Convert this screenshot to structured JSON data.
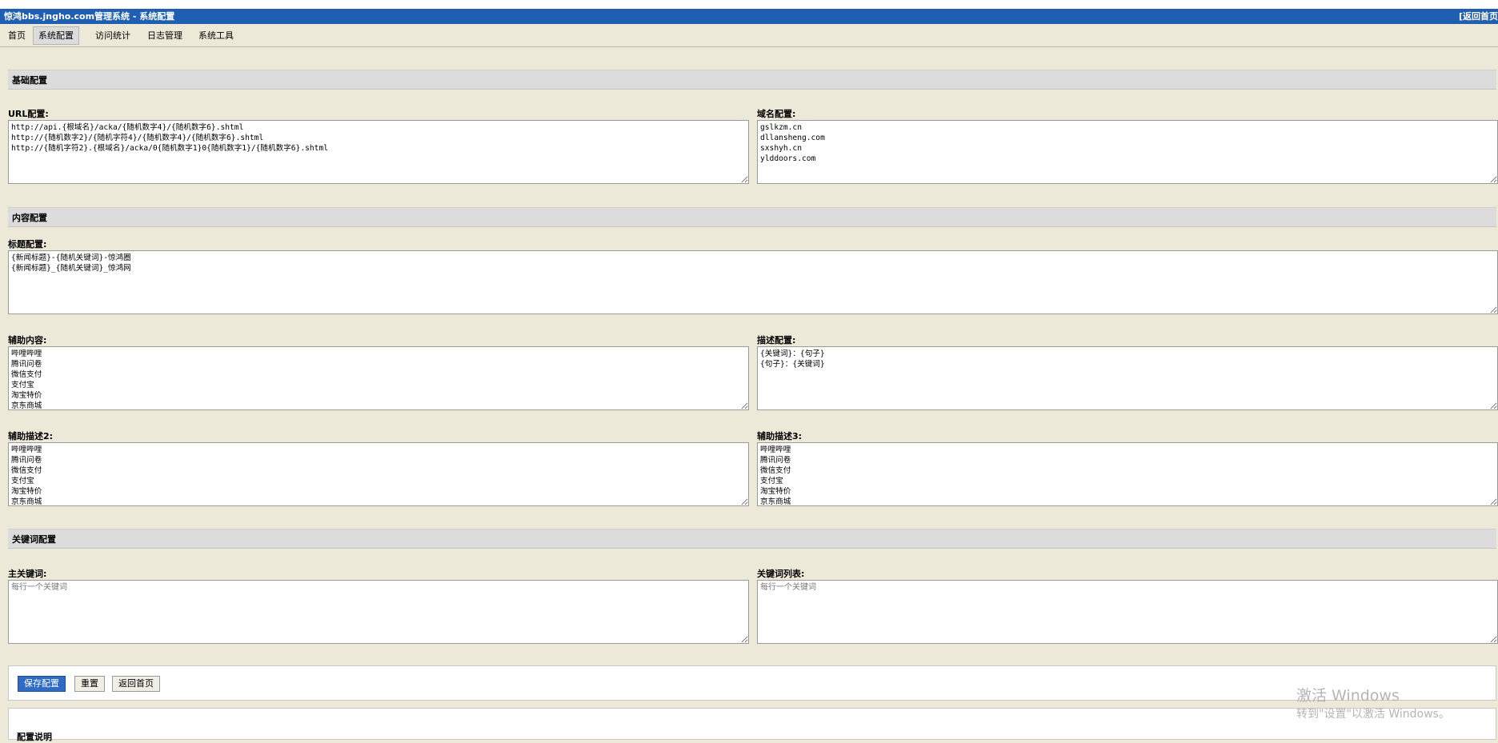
{
  "window": {
    "title": "惊鸿bbs.jngho.com管理系统 - 系统配置",
    "right_link": "[返回首页"
  },
  "menu": [
    {
      "label": "首页",
      "active": false
    },
    {
      "label": "系统配置",
      "active": true
    },
    {
      "label": "访问统计",
      "active": false
    },
    {
      "label": "日志管理",
      "active": false
    },
    {
      "label": "系统工具",
      "active": false
    }
  ],
  "sections": {
    "basic": "基础配置",
    "content": "内容配置",
    "keywords": "关键词配置"
  },
  "fields": {
    "url": {
      "label": "URL配置:",
      "value": "http://api.{根域名}/acka/{随机数字4}/{随机数字6}.shtml\nhttp://{随机数字2}/{随机字符4}/{随机数字4}/{随机数字6}.shtml\nhttp://{随机字符2}.{根域名}/acka/0{随机数字1}0{随机数字1}/{随机数字6}.shtml"
    },
    "domain": {
      "label": "域名配置:",
      "value": "gslkzm.cn\ndllansheng.com\nsxshyh.cn\nylddoors.com"
    },
    "title": {
      "label": "标题配置:",
      "value": "{新闻标题}-{随机关键词}-惊鸿圈\n{新闻标题}_{随机关键词}_惊鸿网"
    },
    "aux_content": {
      "label": "辅助内容:",
      "value": "哔哩哔哩\n腾讯问卷\n微信支付\n支付宝\n淘宝特价\n京东商城"
    },
    "description": {
      "label": "描述配置:",
      "value": "{关键词}：{句子}\n{句子}：{关键词}"
    },
    "aux_desc2": {
      "label": "辅助描述2:",
      "value": "哔哩哔哩\n腾讯问卷\n微信支付\n支付宝\n淘宝特价\n京东商城"
    },
    "aux_desc3": {
      "label": "辅助描述3:",
      "value": "哔哩哔哩\n腾讯问卷\n微信支付\n支付宝\n淘宝特价\n京东商城"
    },
    "main_keyword": {
      "label": "主关键词:",
      "placeholder": "每行一个关键词"
    },
    "keyword_list": {
      "label": "关键词列表:",
      "placeholder": "每行一个关键词"
    }
  },
  "buttons": {
    "save": "保存配置",
    "reset": "重置",
    "back": "返回首页"
  },
  "info": {
    "heading": "配置说明"
  },
  "watermark": {
    "line1": "激活 Windows",
    "line2": "转到\"设置\"以激活 Windows。"
  }
}
